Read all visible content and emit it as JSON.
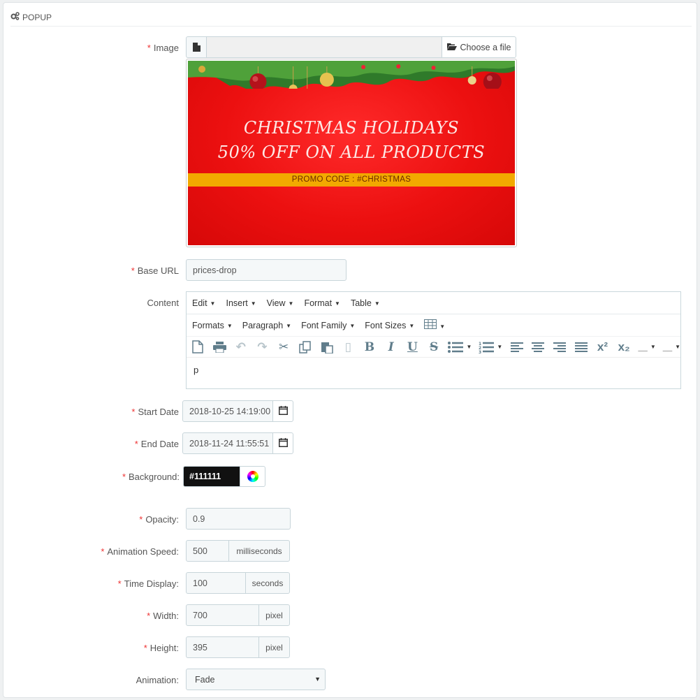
{
  "panel": {
    "title": "POPUP"
  },
  "fields": {
    "image": {
      "label": "Image",
      "choose_label": "Choose a file"
    },
    "banner": {
      "line1": "CHRISTMAS HOLIDAYS",
      "line2": "50% OFF ON ALL PRODUCTS",
      "promo": "PROMO CODE : #CHRISTMAS"
    },
    "base_url": {
      "label": "Base URL",
      "value": "prices-drop"
    },
    "content": {
      "label": "Content",
      "menu": [
        "Edit",
        "Insert",
        "View",
        "Format",
        "Table"
      ],
      "toolbar_dropdowns": [
        "Formats",
        "Paragraph",
        "Font Family",
        "Font Sizes"
      ],
      "body": "p"
    },
    "start_date": {
      "label": "Start Date",
      "value": "2018-10-25 14:19:00"
    },
    "end_date": {
      "label": "End Date",
      "value": "2018-11-24 11:55:51"
    },
    "background": {
      "label": "Background:",
      "value": "#111111"
    },
    "opacity": {
      "label": "Opacity:",
      "value": "0.9"
    },
    "animation_speed": {
      "label": "Animation Speed:",
      "value": "500",
      "unit": "milliseconds"
    },
    "time_display": {
      "label": "Time Display:",
      "value": "100",
      "unit": "seconds"
    },
    "width": {
      "label": "Width:",
      "value": "700",
      "unit": "pixel"
    },
    "height": {
      "label": "Height:",
      "value": "395",
      "unit": "pixel"
    },
    "animation": {
      "label": "Animation:",
      "value": "Fade"
    }
  },
  "colors": {
    "required": "#ee3333",
    "banner_red": "#ec1010",
    "promo_strip": "#f2a900"
  }
}
